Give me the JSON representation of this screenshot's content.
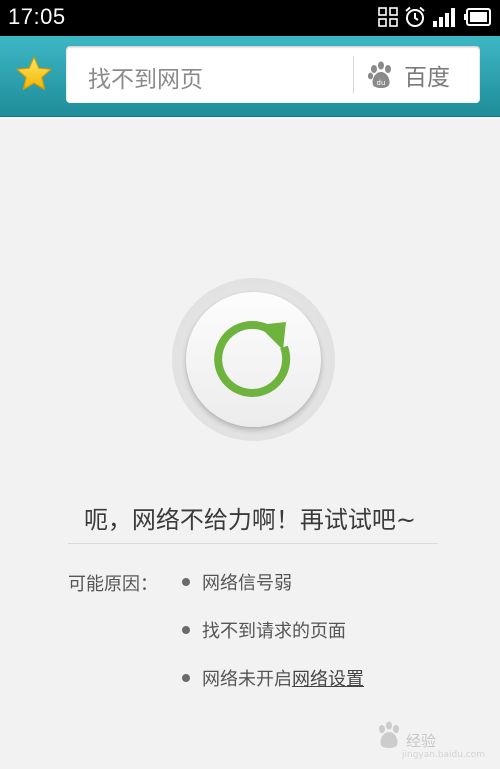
{
  "status_bar": {
    "time": "17:05"
  },
  "toolbar": {
    "address_text": "找不到网页",
    "search_engine": "百度"
  },
  "error": {
    "title": "呃，网络不给力啊！再试试吧~",
    "reasons_label": "可能原因：",
    "reasons": [
      "网络信号弱",
      "找不到请求的页面",
      "网络未开启"
    ],
    "settings_link": "网络设置"
  },
  "watermark": {
    "text": "经验",
    "sub": "jingyan.baidu.com"
  },
  "colors": {
    "toolbar_accent": "#2aa3b0",
    "reload_green": "#6fb33f",
    "star_yellow": "#f7c61f"
  }
}
